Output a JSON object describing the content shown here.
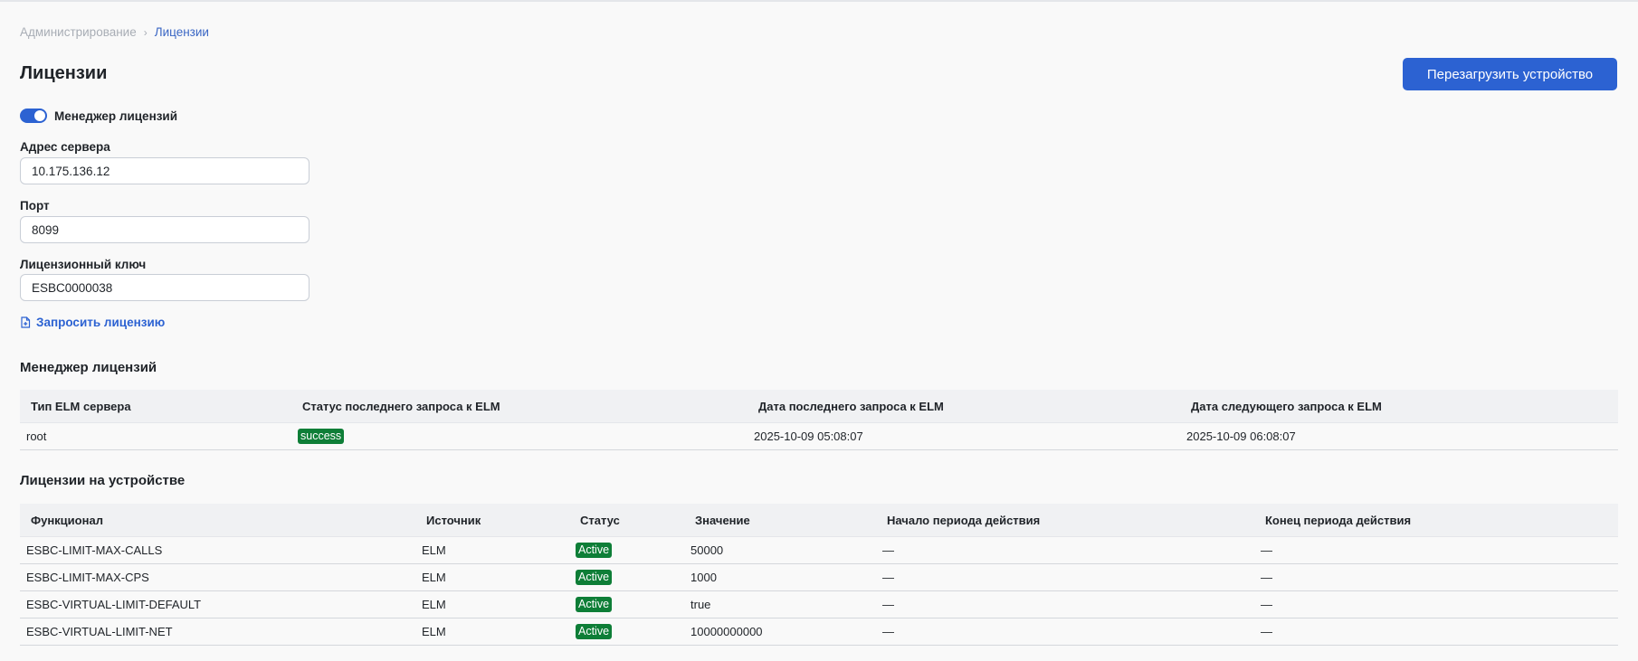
{
  "breadcrumb": {
    "parent": "Администрирование",
    "separator": "›",
    "current": "Лицензии"
  },
  "page": {
    "title": "Лицензии",
    "reboot_button": "Перезагрузить устройство"
  },
  "license_manager_toggle": {
    "label": "Менеджер лицензий",
    "enabled": true
  },
  "fields": {
    "server_address": {
      "label": "Адрес сервера",
      "value": "10.175.136.12"
    },
    "port": {
      "label": "Порт",
      "value": "8099"
    },
    "license_key": {
      "label": "Лицензионный ключ",
      "value": "ESBC0000038"
    }
  },
  "request_license_link": "Запросить лицензию",
  "elm_section": {
    "title": "Менеджер лицензий",
    "columns": [
      "Тип ELM сервера",
      "Статус последнего запроса к ELM",
      "Дата последнего запроса к ELM",
      "Дата следующего запроса к ELM"
    ],
    "rows": [
      {
        "type": "root",
        "status": "success",
        "last": "2025-10-09 05:08:07",
        "next": "2025-10-09 06:08:07"
      }
    ]
  },
  "device_section": {
    "title": "Лицензии на устройстве",
    "columns": [
      "Функционал",
      "Источник",
      "Статус",
      "Значение",
      "Начало периода действия",
      "Конец периода действия"
    ],
    "rows": [
      {
        "feature": "ESBC-LIMIT-MAX-CALLS",
        "source": "ELM",
        "status": "Active",
        "value": "50000",
        "start": "—",
        "end": "—"
      },
      {
        "feature": "ESBC-LIMIT-MAX-CPS",
        "source": "ELM",
        "status": "Active",
        "value": "1000",
        "start": "—",
        "end": "—"
      },
      {
        "feature": "ESBC-VIRTUAL-LIMIT-DEFAULT",
        "source": "ELM",
        "status": "Active",
        "value": "true",
        "start": "—",
        "end": "—"
      },
      {
        "feature": "ESBC-VIRTUAL-LIMIT-NET",
        "source": "ELM",
        "status": "Active",
        "value": "10000000000",
        "start": "—",
        "end": "—"
      }
    ]
  },
  "colors": {
    "accent": "#2c62d2",
    "success_badge": "#0e7e37",
    "background": "#f9f9f9"
  },
  "icons": {
    "request_license": "file-plus-icon",
    "breadcrumb_separator": "chevron-right-icon"
  }
}
